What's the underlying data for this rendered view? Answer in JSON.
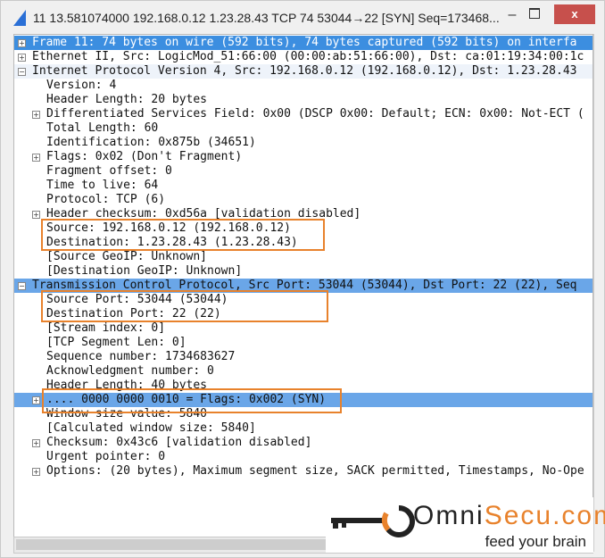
{
  "window": {
    "title": "11 13.581074000 192.168.0.12 1.23.28.43 TCP 74 53044→22 [SYN] Seq=173468...",
    "minimize": "–",
    "close": "x"
  },
  "colors": {
    "selection": "#3c8ee0",
    "highlight": "#6aa6e8",
    "annotation_box": "#e8822c",
    "brand": "#e8822c"
  },
  "tree": [
    {
      "text": "Frame 11: 74 bytes on wire (592 bits), 74 bytes captured (592 bits) on interfa",
      "level": 0,
      "expander": "+",
      "state": "selected"
    },
    {
      "text": "Ethernet II, Src: LogicMod_51:66:00 (00:00:ab:51:66:00), Dst: ca:01:19:34:00:1c",
      "level": 0,
      "expander": "+"
    },
    {
      "text": "Internet Protocol Version 4, Src: 192.168.0.12 (192.168.0.12), Dst: 1.23.28.43",
      "level": 0,
      "expander": "-",
      "state": "header"
    },
    {
      "text": "Version: 4",
      "level": 1
    },
    {
      "text": "Header Length: 20 bytes",
      "level": 1
    },
    {
      "text": "Differentiated Services Field: 0x00 (DSCP 0x00: Default; ECN: 0x00: Not-ECT (",
      "level": 1,
      "expander": "+"
    },
    {
      "text": "Total Length: 60",
      "level": 1
    },
    {
      "text": "Identification: 0x875b (34651)",
      "level": 1
    },
    {
      "text": "Flags: 0x02 (Don't Fragment)",
      "level": 1,
      "expander": "+"
    },
    {
      "text": "Fragment offset: 0",
      "level": 1
    },
    {
      "text": "Time to live: 64",
      "level": 1
    },
    {
      "text": "Protocol: TCP (6)",
      "level": 1
    },
    {
      "text": "Header checksum: 0xd56a [validation disabled]",
      "level": 1,
      "expander": "+"
    },
    {
      "text": "Source: 192.168.0.12 (192.168.0.12)",
      "level": 1
    },
    {
      "text": "Destination: 1.23.28.43 (1.23.28.43)",
      "level": 1
    },
    {
      "text": "[Source GeoIP: Unknown]",
      "level": 1
    },
    {
      "text": "[Destination GeoIP: Unknown]",
      "level": 1
    },
    {
      "text": "Transmission Control Protocol, Src Port: 53044 (53044), Dst Port: 22 (22), Seq",
      "level": 0,
      "expander": "-",
      "state": "highlight"
    },
    {
      "text": "Source Port: 53044 (53044)",
      "level": 1
    },
    {
      "text": "Destination Port: 22 (22)",
      "level": 1
    },
    {
      "text": "[Stream index: 0]",
      "level": 1
    },
    {
      "text": "[TCP Segment Len: 0]",
      "level": 1
    },
    {
      "text": "Sequence number: 1734683627",
      "level": 1
    },
    {
      "text": "Acknowledgment number: 0",
      "level": 1
    },
    {
      "text": "Header Length: 40 bytes",
      "level": 1
    },
    {
      "text": ".... 0000 0000 0010 = Flags: 0x002 (SYN)",
      "level": 1,
      "expander": "+",
      "state": "highlight"
    },
    {
      "text": "Window size value: 5840",
      "level": 1
    },
    {
      "text": "[Calculated window size: 5840]",
      "level": 1
    },
    {
      "text": "Checksum: 0x43c6 [validation disabled]",
      "level": 1,
      "expander": "+"
    },
    {
      "text": "Urgent pointer: 0",
      "level": 1
    },
    {
      "text": "Options: (20 bytes), Maximum segment size, SACK permitted, Timestamps, No-Ope",
      "level": 1,
      "expander": "+"
    }
  ],
  "watermark": {
    "brand_dark": "Omni",
    "brand_orange": "Secu.com",
    "tagline": "feed your brain",
    "icon": "key-icon"
  }
}
